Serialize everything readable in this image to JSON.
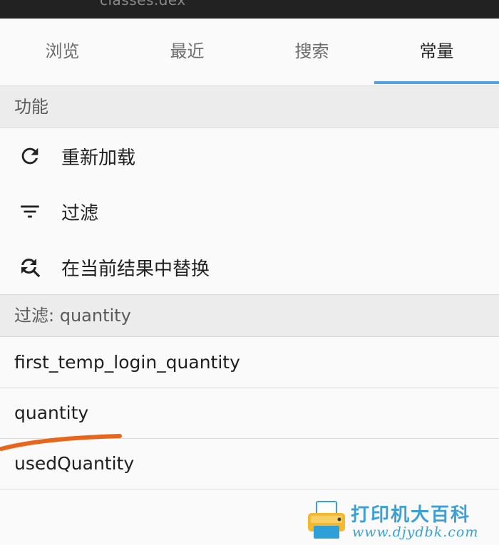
{
  "window": {
    "title": "classes.dex"
  },
  "tabs": [
    {
      "label": "浏览",
      "active": false
    },
    {
      "label": "最近",
      "active": false
    },
    {
      "label": "搜索",
      "active": false
    },
    {
      "label": "常量",
      "active": true
    }
  ],
  "functions": {
    "header": "功能",
    "items": [
      {
        "label": "重新加载",
        "icon": "reload-icon"
      },
      {
        "label": "过滤",
        "icon": "filter-icon"
      },
      {
        "label": "在当前结果中替换",
        "icon": "replace-icon"
      }
    ]
  },
  "filter": {
    "header": "过滤: quantity",
    "results": [
      "first_temp_login_quantity",
      "quantity",
      "usedQuantity"
    ]
  },
  "watermark": {
    "text": "打印机大百科",
    "url": "www.djydbk.com"
  },
  "colors": {
    "accent": "#4fa3e0",
    "annotation": "#e8651c",
    "watermark": "#3aa0d6"
  }
}
